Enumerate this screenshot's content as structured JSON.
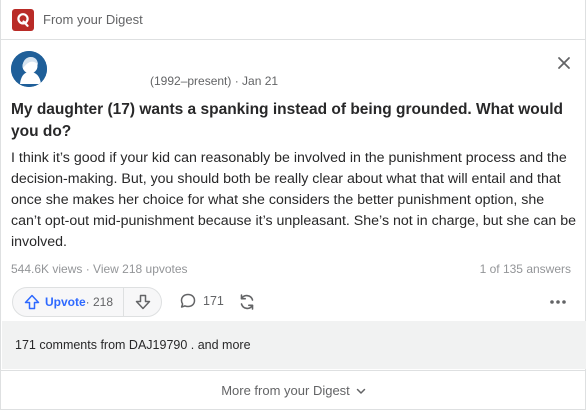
{
  "digest": {
    "title": "From your Digest",
    "brand_color": "#b92b27"
  },
  "author": {
    "meta": "(1992–present) · Jan 21"
  },
  "question": {
    "title": "My daughter (17) wants a spanking instead of being grounded. What would you do?"
  },
  "answer": {
    "text": "I think it’s good if your kid can reasonably be involved in the punishment process and the decision-making. But, you should both be really clear about what that will entail and that once she makes her choice for what she considers the better punishment option, she can’t opt-out mid-punishment because it’s unpleasant. She’s not in charge, but she can be involved."
  },
  "stats": {
    "views": "544.6K views · View 218 upvotes",
    "answers": "1 of 135 answers"
  },
  "actions": {
    "upvote_label": "Upvote",
    "upvote_count": " · 218",
    "comment_count": "171",
    "accent_color": "#2e69ff"
  },
  "comments": {
    "summary": "171 comments from DAJ19790 . and more"
  },
  "footer": {
    "more_label": "More from your Digest"
  },
  "icons": [
    "quora-logo-icon",
    "avatar-icon",
    "close-icon",
    "upvote-arrow-icon",
    "downvote-arrow-icon",
    "comment-icon",
    "share-icon",
    "more-icon",
    "chevron-down-icon"
  ]
}
